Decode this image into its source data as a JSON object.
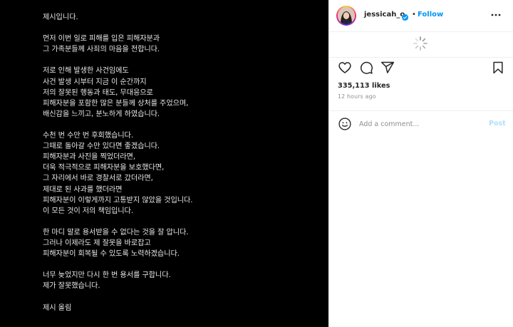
{
  "post": {
    "statement": [
      [
        "제시입니다."
      ],
      [
        "먼저 이번 일로 피해를 입은 피해자분과",
        "그 가족분들께 사죄의 마음을 전합니다."
      ],
      [
        "저로 인해 발생한 사건임에도",
        "사건 발생 시부터 지금 이 순간까지",
        "저의 잘못된 행동과 태도, 무대응으로",
        "피해자분을 포함한 많은 분들께 상처를 주었으며,",
        "배신감을 느끼고, 분노하게 하였습니다."
      ],
      [
        "수천 번 수만 번 후회했습니다.",
        "그때로 돌아갈 수만 있다면 좋겠습니다.",
        "피해자분과 사진을 찍었더라면,",
        "더욱 적극적으로 피해자분을 보호했다면,",
        "그 자리에서 바로 경찰서로 갔더라면,",
        "제대로 된 사과를 했더라면",
        "피해자분이 이렇게까지 고통받지 않았을 것입니다.",
        "이 모든 것이 저의 책임입니다."
      ],
      [
        "한 마디 말로 용서받을 수 없다는 것을 잘 압니다.",
        "그러나 이제라도 제 잘못을 바로잡고",
        "피해자분이 회복될 수 있도록 노력하겠습니다."
      ],
      [
        "너무 늦었지만 다시 한 번 용서를 구합니다.",
        "제가 잘못했습니다."
      ],
      [
        "제시 올림"
      ]
    ]
  },
  "header": {
    "username": "jessicah_o",
    "separator": "•",
    "follow_label": "Follow",
    "verified_icon": "verified-badge-icon",
    "more_icon": "more-options-icon"
  },
  "actions": {
    "like_icon": "heart-icon",
    "comment_icon": "comment-icon",
    "share_icon": "share-icon",
    "save_icon": "bookmark-icon"
  },
  "stats": {
    "likes": "335,113 likes",
    "time": "12 hours ago"
  },
  "comment": {
    "emoji_icon": "emoji-icon",
    "placeholder": "Add a comment...",
    "post_label": "Post"
  },
  "colors": {
    "accent": "#0095f6",
    "post_disabled": "#b2dffc",
    "media_bg": "#000000",
    "text_secondary": "#8e8e8e"
  }
}
